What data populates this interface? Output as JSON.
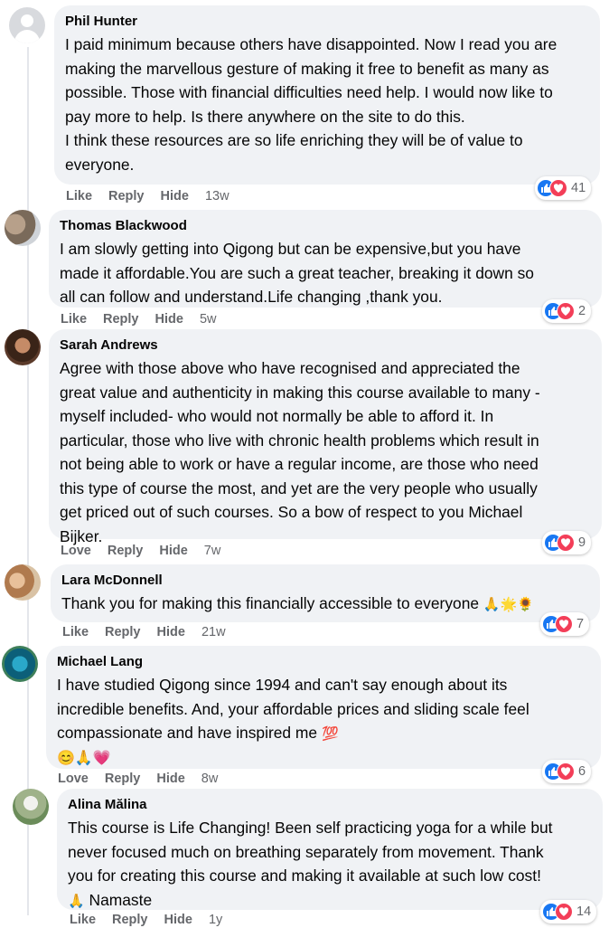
{
  "comments": [
    {
      "name": "Phil Hunter",
      "text": "I paid minimum because others have disappointed. Now I read you are\nmaking the marvellous gesture of making it free to benefit as many as\npossible. Those with financial difficulties need help. I would now like to\npay more to help. Is there anywhere on the site to do this.\nI think these resources are so life enriching they will be of value to\neveryone.",
      "actions": [
        "Like",
        "Reply",
        "Hide"
      ],
      "time": "13w",
      "reaction_count": "41"
    },
    {
      "name": "Thomas Blackwood",
      "text": "I am slowly getting into Qigong but can be expensive,but you have\nmade it affordable.You are such a great teacher, breaking it down so\nall can follow and understand.Life changing ,thank you.",
      "actions": [
        "Like",
        "Reply",
        "Hide"
      ],
      "time": "5w",
      "reaction_count": "2"
    },
    {
      "name": "Sarah Andrews",
      "text": "Agree with those above who have recognised and appreciated the\ngreat value and authenticity in making this course available to many -\nmyself included- who would not normally be able to afford it. In\nparticular, those who live with chronic health problems which result in\nnot being able to work or have a regular income, are those who need\nthis type of course the most, and yet are the very people who usually\nget priced out of such courses. So a bow of respect to you Michael\nBijker.",
      "actions": [
        "Love",
        "Reply",
        "Hide"
      ],
      "time": "7w",
      "reaction_count": "9"
    },
    {
      "name": "Lara McDonnell",
      "text": "Thank you for making this financially accessible to everyone",
      "emoji": "🙏🌟🌻",
      "actions": [
        "Like",
        "Reply",
        "Hide"
      ],
      "time": "21w",
      "reaction_count": "7"
    },
    {
      "name": "Michael Lang",
      "text": "I have studied Qigong since 1994 and can't say enough about its\nincredible benefits. And, your affordable prices and sliding scale feel\ncompassionate and have inspired me",
      "emoji": "💯",
      "emoji_row": "😊🙏💗",
      "actions": [
        "Love",
        "Reply",
        "Hide"
      ],
      "time": "8w",
      "reaction_count": "6"
    },
    {
      "name": "Alina Mălina",
      "text": "This course is Life Changing! Been self practicing yoga for a while but\nnever focused much on breathing separately from movement. Thank\nyou for creating this course and making it available at such low cost!",
      "emoji": "🙏",
      "text_tail": "Namaste",
      "actions": [
        "Like",
        "Reply",
        "Hide"
      ],
      "time": "1y",
      "reaction_count": "14"
    }
  ],
  "colors": {
    "like": "#1877f2",
    "love": "#f33e58",
    "bubble": "#f0f2f5",
    "meta": "#65676b"
  },
  "icons": {
    "like": "thumbs-up-icon",
    "love": "heart-icon"
  }
}
